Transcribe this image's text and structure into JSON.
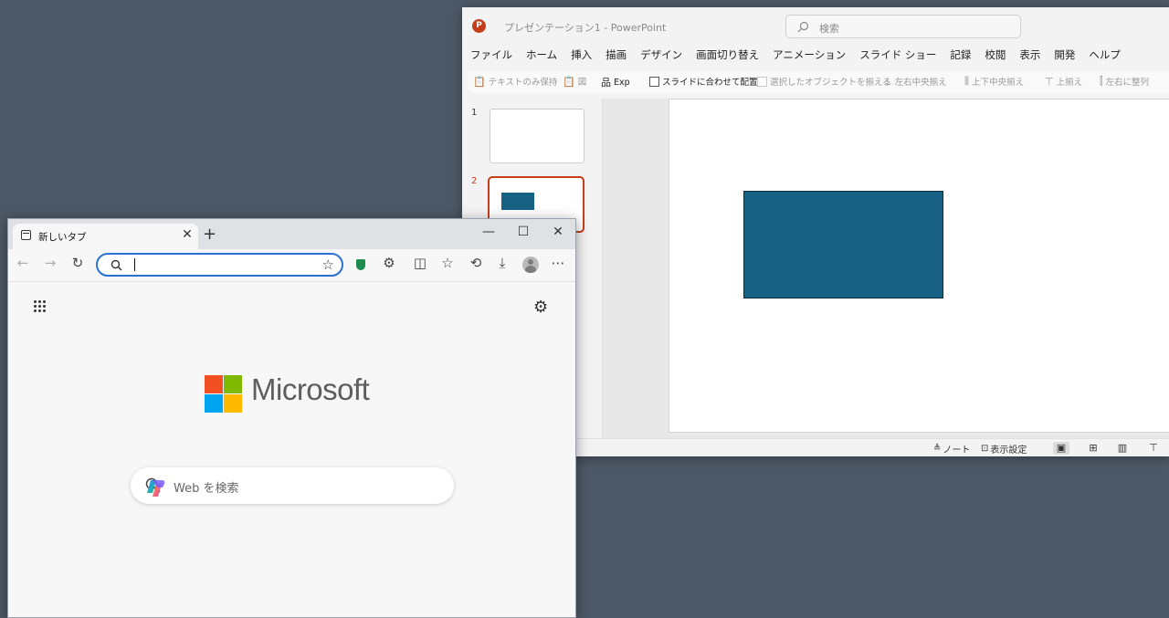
{
  "powerpoint": {
    "title": "プレゼンテーション1 - PowerPoint",
    "search_placeholder": "検索",
    "menu": [
      "ファイル",
      "ホーム",
      "挿入",
      "描画",
      "デザイン",
      "画面切り替え",
      "アニメーション",
      "スライド ショー",
      "記録",
      "校閲",
      "表示",
      "開発",
      "ヘルプ"
    ],
    "ribbon": {
      "keep_text_only": "テキストのみ保持",
      "picture": "図",
      "exp": "Exp",
      "fit_to_slide": "スライドに合わせて配置",
      "align_selected": "選択したオブジェクトを揃える",
      "align_center": "左右中央揃え",
      "align_middle": "上下中央揃え",
      "align_top": "上揃え",
      "distribute_h": "左右に整列"
    },
    "slides": [
      {
        "number": "1"
      },
      {
        "number": "2"
      }
    ],
    "shape_color": "#176185",
    "status": {
      "notes": "ノート",
      "display_settings": "表示設定"
    },
    "accent": "#c43e1c"
  },
  "edge": {
    "tab_title": "新しいタブ",
    "address_value": "",
    "brand": "Microsoft",
    "search_placeholder": "Web を検索",
    "accent": "#2b6fd1"
  }
}
